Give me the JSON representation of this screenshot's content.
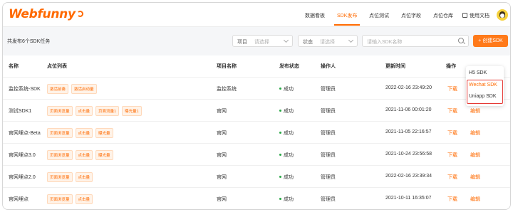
{
  "header": {
    "logo_text": "Webfunny",
    "nav": [
      {
        "label": "数据看板",
        "active": false
      },
      {
        "label": "SDK发布",
        "active": true
      },
      {
        "label": "点位测试",
        "active": false
      },
      {
        "label": "点位字段",
        "active": false
      },
      {
        "label": "点位仓库",
        "active": false
      },
      {
        "label": "使用文档",
        "active": false
      }
    ]
  },
  "toolbar": {
    "total_text": "共发布6个SDK任务",
    "project_label": "项目",
    "project_placeholder": "请选择",
    "status_label": "状态",
    "status_placeholder": "请选择",
    "search_placeholder": "请输入SDK名称",
    "create_label": "+ 创建SDK"
  },
  "table": {
    "headers": {
      "name": "名称",
      "points": "点位列表",
      "project": "项目名称",
      "status": "发布状态",
      "operator": "操作人",
      "updated": "更新时间",
      "actions": "操作"
    },
    "rows": [
      {
        "name": "监控系统-SDK",
        "tags": [
          "激活前奏",
          "激活启动量"
        ],
        "project": "监控系统",
        "status": "成功",
        "operator": "管理员",
        "updated": "2022-02-16 23:49:20",
        "download": "下载",
        "edit": "编辑"
      },
      {
        "name": "测试SDK1",
        "tags": [
          "页面浏览量",
          "点击量",
          "页面流量1",
          "曝光量1"
        ],
        "project": "官网",
        "status": "成功",
        "operator": "管理员",
        "updated": "2021-11-06 00:01:20",
        "download": "下载",
        "edit": "编辑"
      },
      {
        "name": "官网埋点-Beta",
        "tags": [
          "页面浏览量",
          "点击量",
          "曝光量"
        ],
        "project": "官网",
        "status": "成功",
        "operator": "管理员",
        "updated": "2021-11-05 22:16:57",
        "download": "下载",
        "edit": "编辑"
      },
      {
        "name": "官网埋点3.0",
        "tags": [
          "页面浏览量",
          "点击量",
          "曝光量"
        ],
        "project": "官网",
        "status": "成功",
        "operator": "管理员",
        "updated": "2021-10-24 23:56:58",
        "download": "下载",
        "edit": "编辑"
      },
      {
        "name": "官网埋点2.0",
        "tags": [
          "页面浏览量",
          "点击量"
        ],
        "project": "官网",
        "status": "成功",
        "operator": "管理员",
        "updated": "2022-02-16 23:39:34",
        "download": "下载",
        "edit": "编辑"
      },
      {
        "name": "官网埋点",
        "tags": [
          "页面浏览量",
          "点击量"
        ],
        "project": "官网",
        "status": "成功",
        "operator": "管理员",
        "updated": "2021-10-11 16:35:07",
        "download": "下载",
        "edit": "编辑"
      }
    ]
  },
  "download_menu": {
    "items": [
      "H5 SDK",
      "Wechat SDK",
      "Uniapp SDK"
    ],
    "highlighted_color": "#e53935"
  },
  "colors": {
    "accent": "#ff6a00",
    "success": "#28a745"
  }
}
